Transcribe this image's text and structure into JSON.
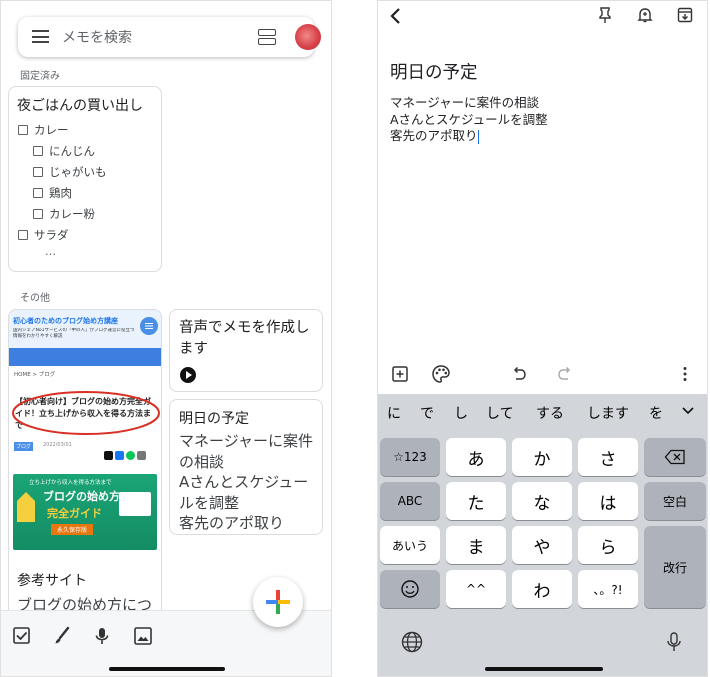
{
  "left": {
    "search": {
      "placeholder": "メモを検索"
    },
    "pinned_label": "固定済み",
    "pinned_note": {
      "title": "夜ごはんの買い出し",
      "items": [
        {
          "text": "カレー",
          "indent": 0
        },
        {
          "text": "にんじん",
          "indent": 1
        },
        {
          "text": "じゃがいも",
          "indent": 1
        },
        {
          "text": "鶏肉",
          "indent": 1
        },
        {
          "text": "カレー粉",
          "indent": 1
        },
        {
          "text": "サラダ",
          "indent": 0
        }
      ],
      "more": "…"
    },
    "others_label": "その他",
    "blog_card": {
      "banner_title": "初心者のためのブログ始め方講座",
      "banner_sub": "国内シェアNo1サービスの「中の人」がブログ運営に役立つ情報をわかりやすく解説",
      "breadcrumb": "HOME > ブログ",
      "headline": "【初心者向け】ブログの始め方完全ガイド！立ち上げから収入を得る方法まで",
      "tag": "ブログ",
      "date": "2022/03/01",
      "promo_top": "立ち上げから収入を得る方法まで",
      "promo_title_1": "ブログの始め方",
      "promo_title_2": "完全ガイド",
      "promo_badge": "永久保存版",
      "note_title": "参考サイト",
      "note_body": "ブログの始め方につ"
    },
    "voice_card": {
      "title": "音声でメモを作成します"
    },
    "plan_card": {
      "title": "明日の予定",
      "lines": [
        "マネージャーに案件の相談",
        "Aさんとスケジュールを調整",
        "客先のアポ取り"
      ]
    }
  },
  "right": {
    "note_title": "明日の予定",
    "note_lines": [
      "マネージャーに案件の相談",
      "Aさんとスケジュールを調整",
      "客先のアポ取り"
    ],
    "candidates": [
      "に",
      "で",
      "し",
      "して",
      "する",
      "します",
      "を"
    ],
    "keys": {
      "num": "☆123",
      "abc": "ABC",
      "kana": "あいう",
      "a": "あ",
      "ka": "か",
      "sa": "さ",
      "ta": "た",
      "na": "な",
      "ha": "は",
      "ma": "ま",
      "ya": "や",
      "ra": "ら",
      "dakuten": "^^",
      "wa": "わ",
      "punct": "、。?!",
      "space": "空白",
      "enter": "改行"
    }
  },
  "colors": {
    "accent": "#f4b400",
    "red_circle": "#d93025",
    "banner_blue": "#1a73e8"
  }
}
